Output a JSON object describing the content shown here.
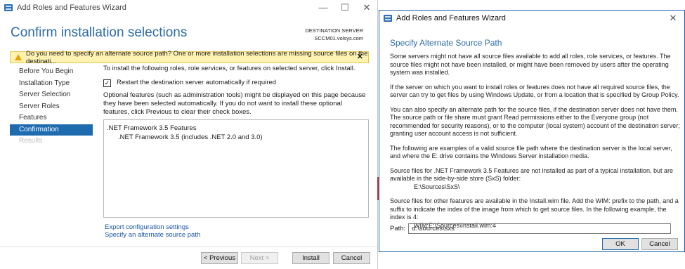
{
  "main_window": {
    "title": "Add Roles and Features Wizard",
    "controls": {
      "minimize": "—",
      "maximize": "☐",
      "close": "✕"
    },
    "header_title": "Confirm installation selections",
    "destination_label": "DESTINATION SERVER",
    "destination_server": "SCCM01.volsys.com",
    "warning": "Do you need to specify an alternate source path? One or more installation selections are missing source files on the destinati...",
    "warning_close": "✕",
    "nav": [
      {
        "label": "Before You Begin",
        "state": "normal"
      },
      {
        "label": "Installation Type",
        "state": "normal"
      },
      {
        "label": "Server Selection",
        "state": "normal"
      },
      {
        "label": "Server Roles",
        "state": "normal"
      },
      {
        "label": "Features",
        "state": "normal"
      },
      {
        "label": "Confirmation",
        "state": "active"
      },
      {
        "label": "Results",
        "state": "disabled"
      }
    ],
    "intro": "To install the following roles, role services, or features on selected server, click Install.",
    "restart_checkbox_label": "Restart the destination server automatically if required",
    "restart_checked": true,
    "optional_text": "Optional features (such as administration tools) might be displayed on this page because they have been selected automatically. If you do not want to install these optional features, click Previous to clear their check boxes.",
    "features": {
      "parent": ".NET Framework 3.5 Features",
      "child": ".NET Framework 3.5 (includes .NET 2.0 and 3.0)"
    },
    "links": {
      "export": "Export configuration settings",
      "alternate_source": "Specify an alternate source path"
    },
    "buttons": {
      "previous": "< Previous",
      "next": "Next >",
      "install": "Install",
      "cancel": "Cancel"
    }
  },
  "dialog": {
    "title": "Add Roles and Features Wizard",
    "close": "✕",
    "heading": "Specify Alternate Source Path",
    "paragraphs": {
      "p1": "Some servers might not have all source files available to add all roles, role services, or features. The source files might not have been installed, or might have been removed by users after the operating system was installed.",
      "p2": "If the server on which you want to install roles or features does not have all required source files, the server can try to get files by using Windows Update, or from a location that is specified by Group Policy.",
      "p3": "You can also specify an alternate path for the source files, if the destination server does not have them. The source path or file share must grant Read permissions either to the Everyone group (not recommended for security reasons), or to the computer (local system) account of the destination server; granting user account access is not sufficient.",
      "p4": "The following are examples of a valid source file path where the destination server is the local server, and where the E: drive contains the Windows Server installation media.",
      "p5": "Source files for .NET Framework 3.5 Features are not installed as part of a typical installation, but are available in the side-by-side store (SxS) folder:",
      "p5_path": "E:\\Sources\\SxS\\",
      "p6": "Source files for other features are available in the Install.wim file. Add the WIM: prefix to the path, and a suffix to indicate the index of the image from which to get source files. In the following example, the index is 4:",
      "p6_path": "WIM:E:\\Sources\\Install.wim:4"
    },
    "path_label": "Path:",
    "path_value": "d:\\sources\\sxs",
    "ok": "OK",
    "cancel": "Cancel"
  }
}
